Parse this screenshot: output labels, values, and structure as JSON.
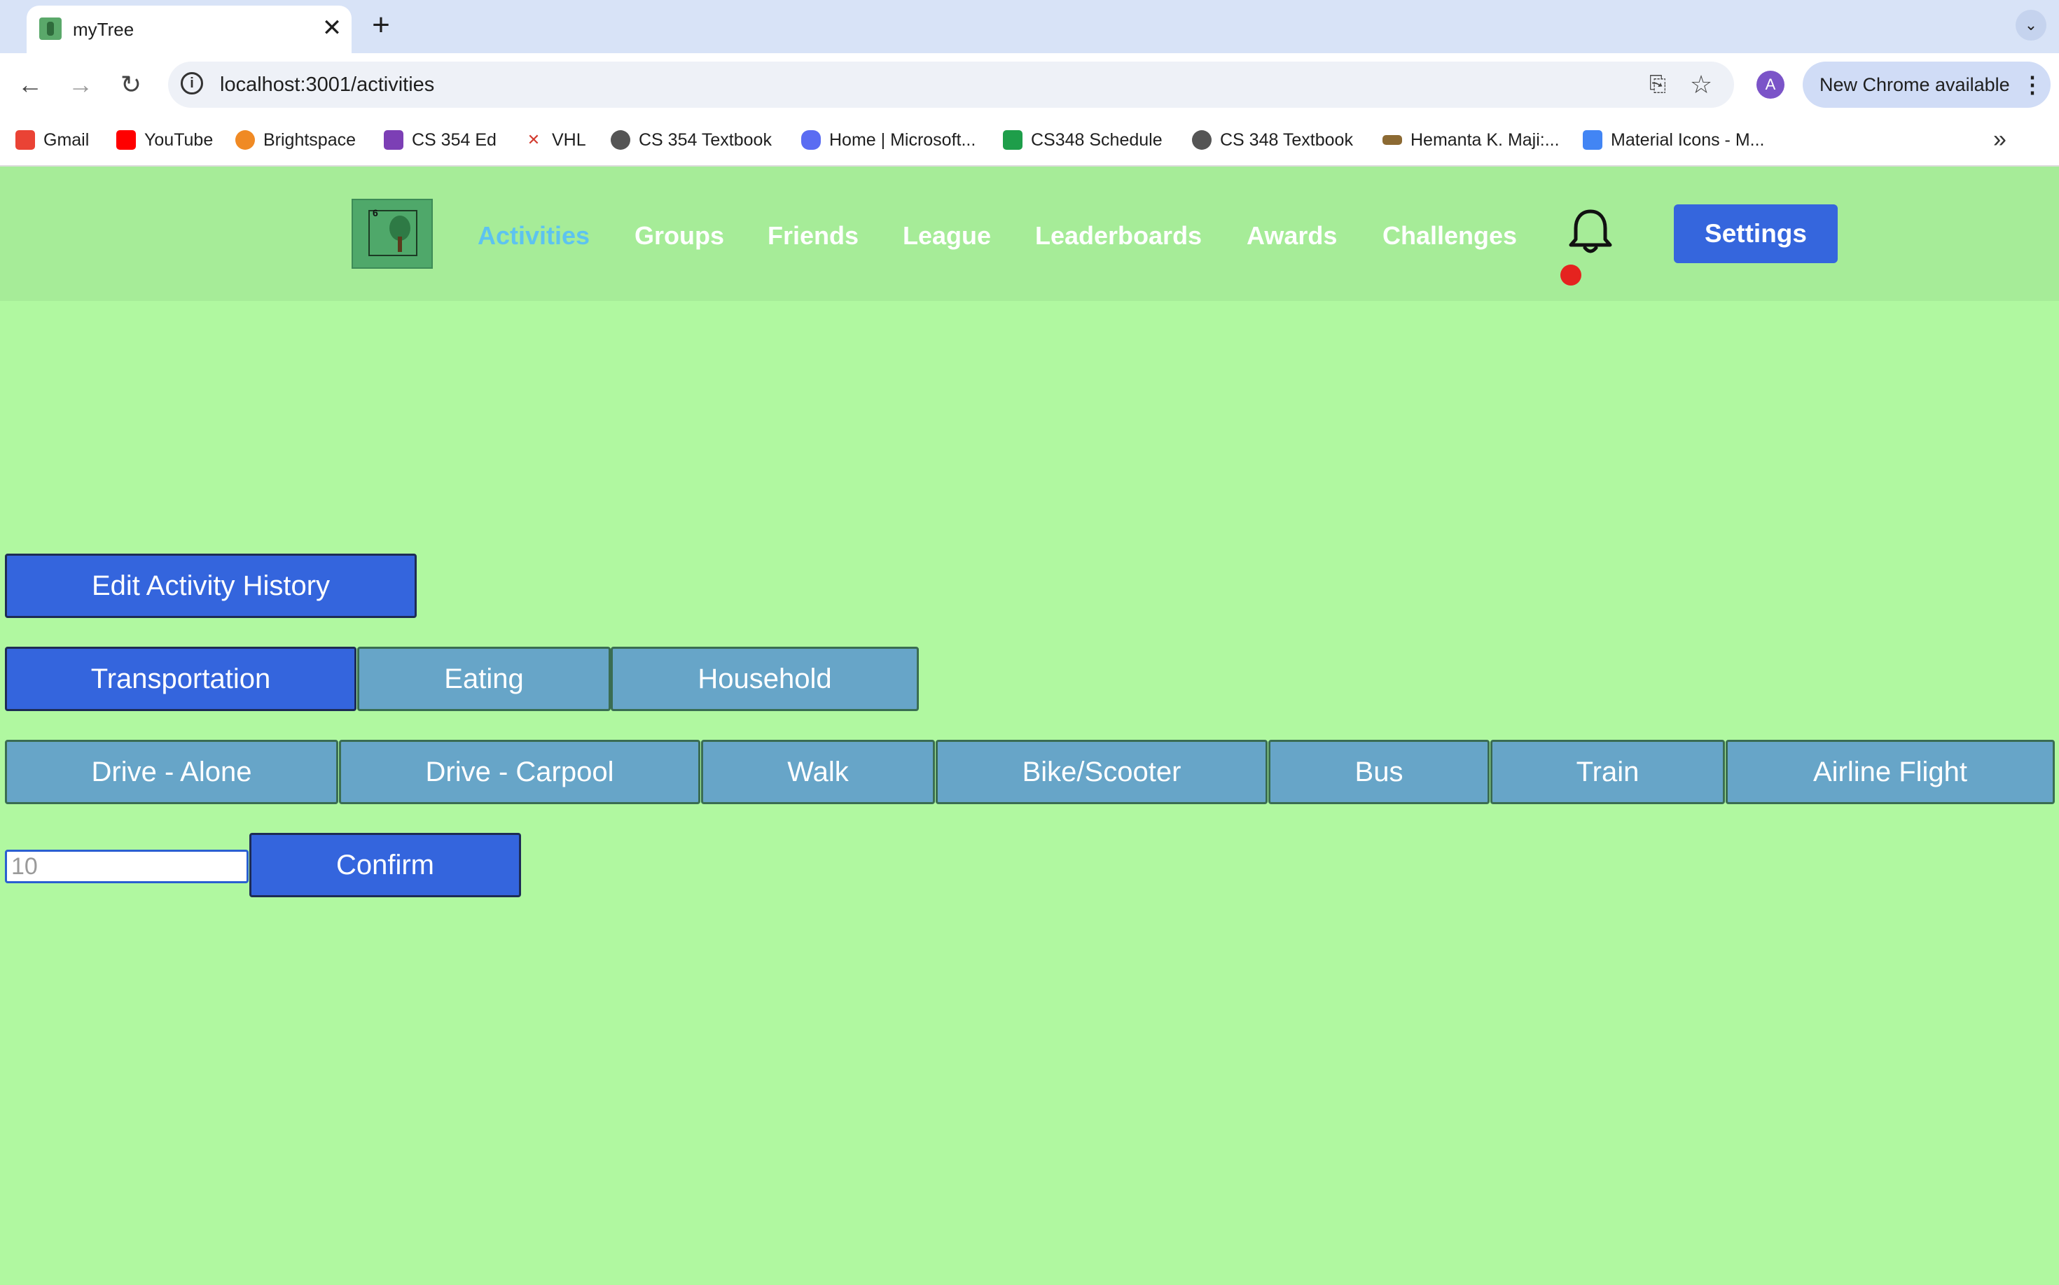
{
  "browser": {
    "tab_title": "myTree",
    "tab_close": "✕",
    "new_tab": "+",
    "tab_search": "⌄",
    "url": "localhost:3001/activities",
    "avatar_letter": "A",
    "update_label": "New Chrome available",
    "bookmarks": [
      {
        "label": "Gmail",
        "icon_color": "#ea4335"
      },
      {
        "label": "YouTube",
        "icon_color": "#ff0000"
      },
      {
        "label": "Brightspace",
        "icon_color": "#f08a24"
      },
      {
        "label": "CS 354 Ed",
        "icon_color": "#7c3fb5"
      },
      {
        "label": "VHL",
        "icon_color": "#d23b2f"
      },
      {
        "label": "CS 354 Textbook",
        "icon_color": "#555555"
      },
      {
        "label": "Home | Microsoft...",
        "icon_color": "#5a6cf2"
      },
      {
        "label": "CS348 Schedule",
        "icon_color": "#1e9e4a"
      },
      {
        "label": "CS 348 Textbook",
        "icon_color": "#555555"
      },
      {
        "label": "Hemanta K. Maji:...",
        "icon_color": "#8c6a33"
      },
      {
        "label": "Material Icons - M...",
        "icon_color": "#4285f4"
      }
    ],
    "bookmarks_more": "»"
  },
  "header": {
    "logo_number": "6",
    "nav": [
      {
        "label": "Activities",
        "active": true
      },
      {
        "label": "Groups",
        "active": false
      },
      {
        "label": "Friends",
        "active": false
      },
      {
        "label": "League",
        "active": false
      },
      {
        "label": "Leaderboards",
        "active": false
      },
      {
        "label": "Awards",
        "active": false
      },
      {
        "label": "Challenges",
        "active": false
      }
    ],
    "settings_label": "Settings"
  },
  "main": {
    "edit_history_label": "Edit Activity History",
    "categories": [
      {
        "label": "Transportation",
        "selected": true
      },
      {
        "label": "Eating",
        "selected": false
      },
      {
        "label": "Household",
        "selected": false
      }
    ],
    "modes": [
      "Drive - Alone",
      "Drive - Carpool",
      "Walk",
      "Bike/Scooter",
      "Bus",
      "Train",
      "Airline Flight"
    ],
    "quantity_placeholder": "10",
    "confirm_label": "Confirm"
  },
  "colors": {
    "page_bg": "#b0f8a0",
    "header_bg": "#a6ec98",
    "primary": "#3465dd",
    "category": "#67a5c8",
    "active_nav": "#5dc3f0",
    "notification": "#e5231f"
  }
}
